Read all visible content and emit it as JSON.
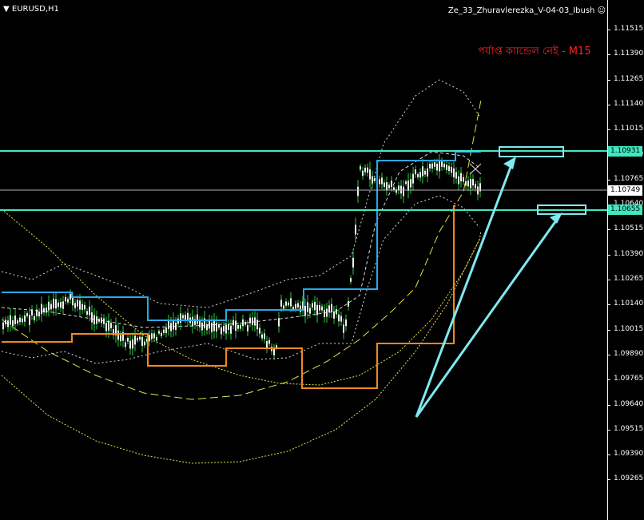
{
  "chart": {
    "symbol": "EURUSD,H1",
    "indicator_label": "Ze_33_Zhuravlerezka_V-04-03_Ibush",
    "smiley_icon": "smiley-face-icon",
    "notice_text": "পর্যাপ্ত ক্যান্ডেল নেই - M15",
    "notice_color": "#ff2020",
    "background_color": "#000000"
  },
  "price_axis": {
    "ticks": [
      "1.11515",
      "1.11390",
      "1.11265",
      "1.11140",
      "1.11015",
      "1.10890",
      "1.10765",
      "1.10640",
      "1.10515",
      "1.10390",
      "1.10265",
      "1.10140",
      "1.10015",
      "1.09890",
      "1.09765",
      "1.09640",
      "1.09515",
      "1.09390",
      "1.09265"
    ],
    "current_price": "1.10749",
    "level_upper": "1.10931",
    "level_lower": "1.10655",
    "level_color": "#40e8c0"
  },
  "chart_data": {
    "type": "candlestick",
    "title": "EURUSD,H1",
    "ylim": [
      1.0922,
      1.1162
    ],
    "current_price": 1.10749,
    "horizontal_levels": [
      1.10931,
      1.10655
    ],
    "annotations": [
      "পর্যাপ্ত ক্যান্ডেল নেই - M15"
    ],
    "grid": false
  }
}
